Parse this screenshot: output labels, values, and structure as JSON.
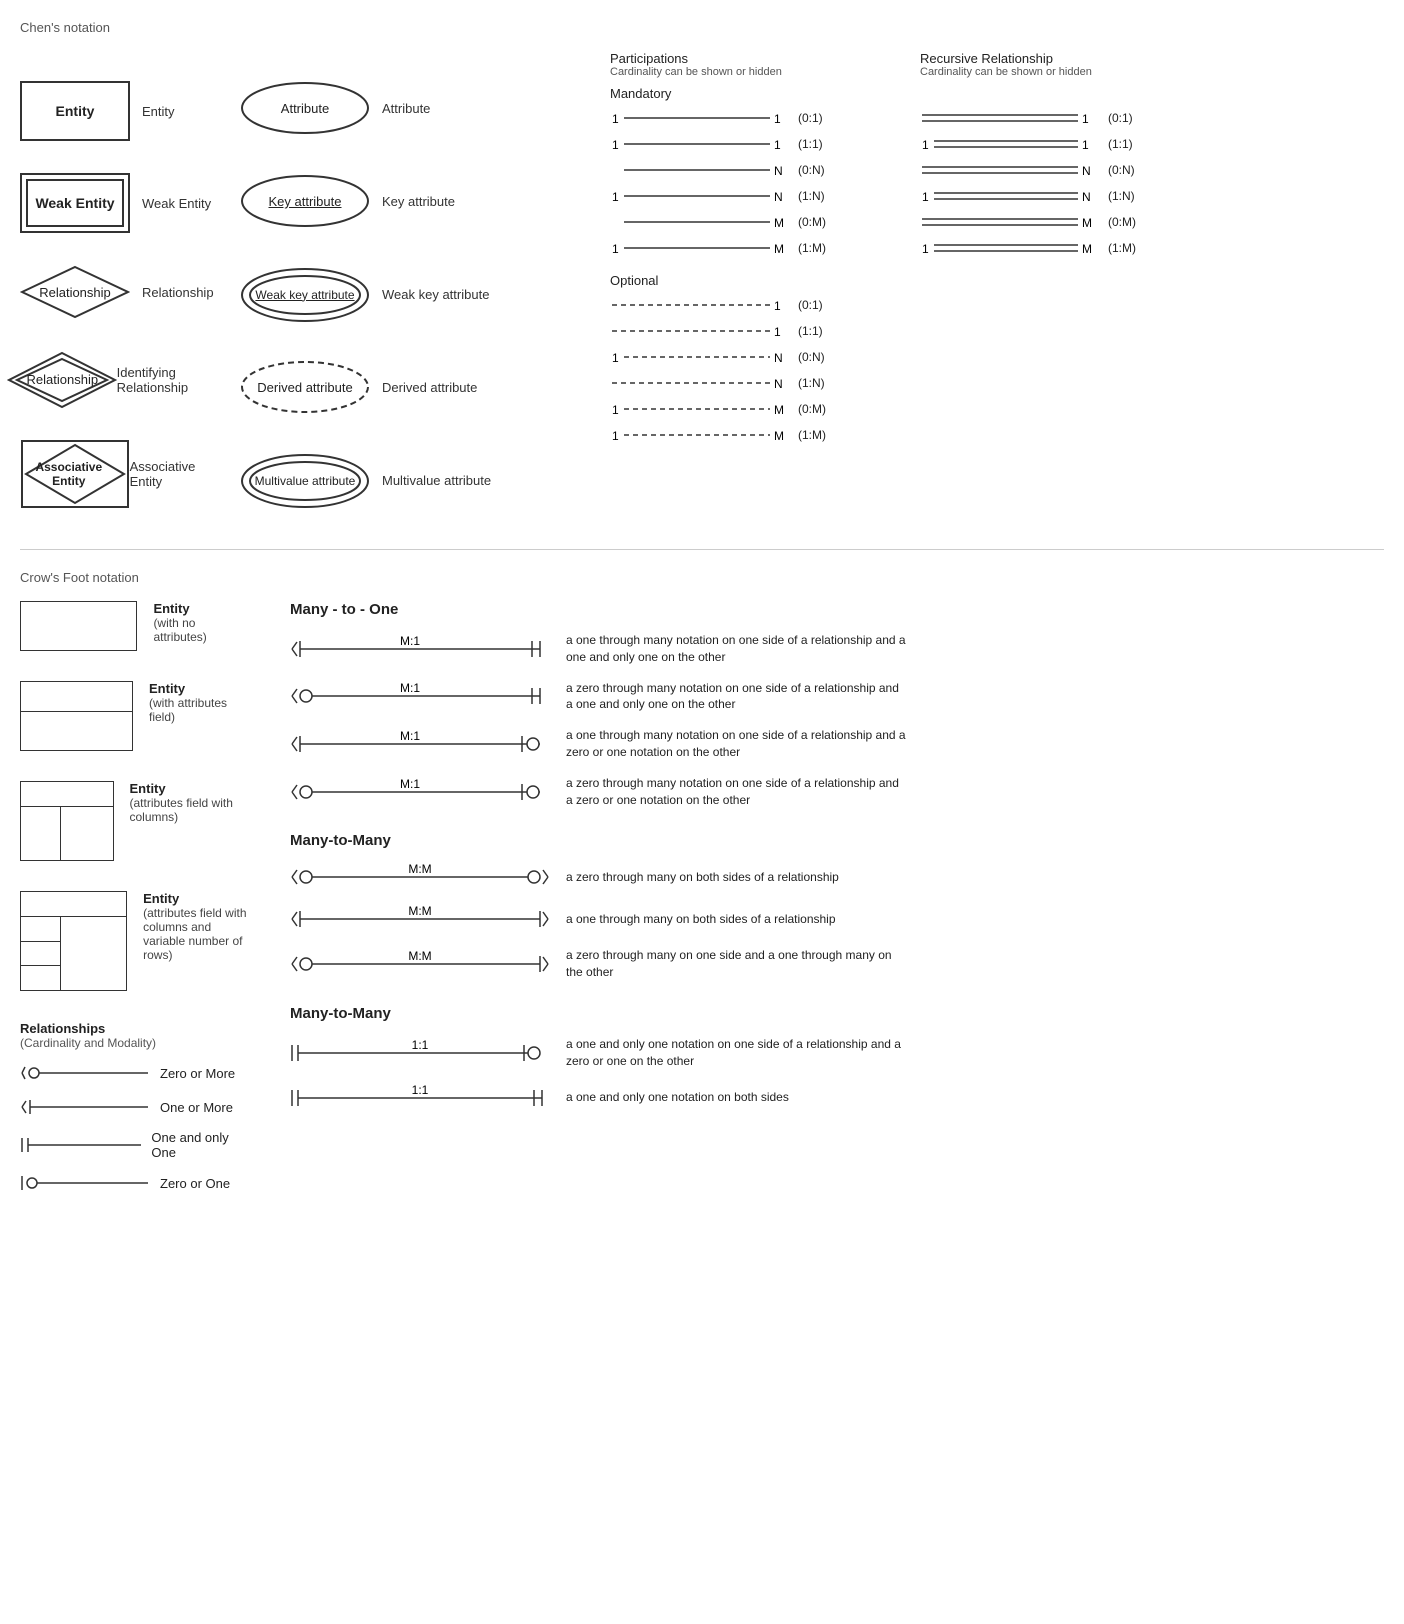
{
  "chens": {
    "title": "Chen's notation",
    "items": [
      {
        "shape": "entity",
        "shapeLabel": "Entity",
        "name": "Entity"
      },
      {
        "shape": "weak-entity",
        "shapeLabel": "Weak Entity",
        "name": "Weak Entity"
      },
      {
        "shape": "relationship",
        "shapeLabel": "Relationship",
        "name": "Relationship"
      },
      {
        "shape": "identifying-relationship",
        "shapeLabel": "Relationship",
        "name": "Identifying Relationship"
      },
      {
        "shape": "associative-entity",
        "shapeLabel": "Associative Entity",
        "name": "Associative Entity"
      }
    ],
    "attributes": [
      {
        "shape": "ellipse",
        "shapeLabel": "Attribute",
        "name": "Attribute"
      },
      {
        "shape": "key-attribute",
        "shapeLabel": "Key attribute",
        "name": "Key attribute"
      },
      {
        "shape": "weak-key-attribute",
        "shapeLabel": "Weak key attribute",
        "name": "Weak key attribute"
      },
      {
        "shape": "derived-attribute",
        "shapeLabel": "Derived attribute",
        "name": "Derived attribute"
      },
      {
        "shape": "multivalue-attribute",
        "shapeLabel": "Multivalue attribute",
        "name": "Multivalue attribute"
      }
    ]
  },
  "participations": {
    "title": "Participations",
    "subtitle": "Cardinality can be shown or hidden",
    "mandatory_label": "Mandatory",
    "optional_label": "Optional",
    "mandatory_items": [
      {
        "left": "1",
        "right": "1",
        "label": "(0:1)"
      },
      {
        "left": "1",
        "right": "1",
        "label": "(1:1)"
      },
      {
        "left": "",
        "right": "N",
        "label": "(0:N)"
      },
      {
        "left": "1",
        "right": "N",
        "label": "(1:N)"
      },
      {
        "left": "",
        "right": "M",
        "label": "(0:M)"
      },
      {
        "left": "1",
        "right": "M",
        "label": "(1:M)"
      }
    ],
    "optional_items": [
      {
        "left": "",
        "right": "1",
        "label": "(0:1)"
      },
      {
        "left": "",
        "right": "1",
        "label": "(1:1)"
      },
      {
        "left": "1",
        "right": "N",
        "label": "(0:N)"
      },
      {
        "left": "",
        "right": "N",
        "label": "(1:N)"
      },
      {
        "left": "1",
        "right": "M",
        "label": "(0:M)"
      },
      {
        "left": "1",
        "right": "M",
        "label": "(1:M)"
      }
    ]
  },
  "recursive": {
    "title": "Recursive Relationship",
    "subtitle": "Cardinality can be shown or hidden",
    "items": [
      {
        "left": "",
        "right": "1",
        "label": "(0:1)"
      },
      {
        "left": "1",
        "right": "1",
        "label": "(1:1)"
      },
      {
        "left": "",
        "right": "N",
        "label": "(0:N)"
      },
      {
        "left": "1",
        "right": "N",
        "label": "(1:N)"
      },
      {
        "left": "",
        "right": "M",
        "label": "(0:M)"
      },
      {
        "left": "1",
        "right": "M",
        "label": "(1:M)"
      }
    ]
  },
  "crows": {
    "title": "Crow's Foot notation",
    "entities": [
      {
        "type": "simple",
        "name": "Entity",
        "sub": "(with no attributes)"
      },
      {
        "type": "attrs",
        "name": "Entity",
        "sub": "(with attributes field)"
      },
      {
        "type": "cols",
        "name": "Entity",
        "sub": "(attributes field with columns)"
      },
      {
        "type": "varrows",
        "name": "Entity",
        "sub": "(attributes field with columns and variable number of rows)"
      }
    ],
    "legend_title": "Relationships",
    "legend_sub": "(Cardinality and Modality)",
    "legend_items": [
      {
        "symbol": "zero-or-more",
        "label": "Zero or More"
      },
      {
        "symbol": "one-or-more",
        "label": "One or More"
      },
      {
        "symbol": "one-only",
        "label": "One and only One"
      },
      {
        "symbol": "zero-or-one",
        "label": "Zero or One"
      }
    ],
    "many_to_one_title": "Many - to - One",
    "many_to_one_items": [
      {
        "label": "M:1",
        "left_type": "one-or-more",
        "right_type": "one-only",
        "desc": "a one through many notation on one side of a relationship and a one and only one on the other"
      },
      {
        "label": "M:1",
        "left_type": "zero-or-more",
        "right_type": "one-only",
        "desc": "a zero through many notation on one side of a relationship and a one and only one on the other"
      },
      {
        "label": "M:1",
        "left_type": "one-or-more",
        "right_type": "zero-or-one",
        "desc": "a one through many notation on one side of a relationship and a zero or one notation on the other"
      },
      {
        "label": "M:1",
        "left_type": "zero-or-more",
        "right_type": "zero-or-one",
        "desc": "a zero through many notation on one side of a relationship and a zero or one notation on the other"
      }
    ],
    "many_to_many_title": "Many-to-Many",
    "many_to_many_items": [
      {
        "label": "M:M",
        "left_type": "zero-or-more",
        "right_type": "zero-or-more",
        "desc": "a zero through many on both sides of a relationship"
      },
      {
        "label": "M:M",
        "left_type": "one-or-more",
        "right_type": "one-or-more",
        "desc": "a one through many on both sides of a relationship"
      },
      {
        "label": "M:M",
        "left_type": "zero-or-more",
        "right_type": "one-or-more",
        "desc": "a zero through many on one side and a one through many on the other"
      }
    ],
    "one_to_one_title": "Many-to-Many",
    "one_to_one_items": [
      {
        "label": "1:1",
        "left_type": "one-only",
        "right_type": "zero-or-one",
        "desc": "a one and only one notation on one side of a relationship and a zero or one on the other"
      },
      {
        "label": "1:1",
        "left_type": "one-only",
        "right_type": "one-only",
        "desc": "a one and only one notation on both sides"
      }
    ]
  }
}
